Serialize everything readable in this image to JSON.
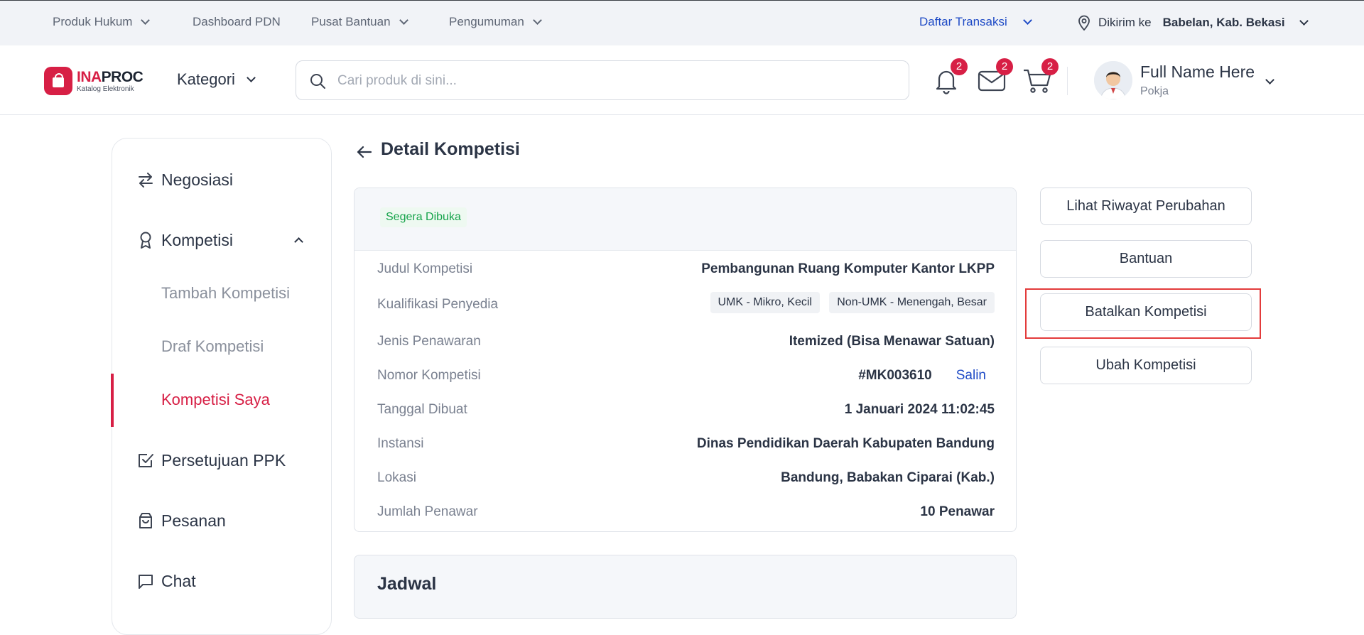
{
  "topbar": {
    "produk_hukum": "Produk Hukum",
    "dashboard_pdn": "Dashboard PDN",
    "pusat_bantuan": "Pusat Bantuan",
    "pengumuman": "Pengumuman",
    "daftar_transaksi": "Daftar Transaksi",
    "dikirim_label": "Dikirim ke",
    "dikirim_value": "Babelan, Kab. Bekasi"
  },
  "header": {
    "logo_ina": "INA",
    "logo_proc": "PROC",
    "logo_sub": "Katalog Elektronik",
    "kategori": "Kategori",
    "search_placeholder": "Cari produk di sini...",
    "notif_count": "2",
    "mail_count": "2",
    "cart_count": "2",
    "user_name": "Full Name Here",
    "user_role": "Pokja"
  },
  "sidebar": {
    "negosiasi": "Negosiasi",
    "kompetisi": "Kompetisi",
    "tambah_kompetisi": "Tambah Kompetisi",
    "draf_kompetisi": "Draf Kompetisi",
    "kompetisi_saya": "Kompetisi Saya",
    "persetujuan_ppk": "Persetujuan PPK",
    "pesanan": "Pesanan",
    "chat": "Chat"
  },
  "page": {
    "title": "Detail Kompetisi",
    "status": "Segera Dibuka",
    "fields": {
      "judul_label": "Judul Kompetisi",
      "judul_value": "Pembangunan Ruang Komputer Kantor LKPP",
      "kualifikasi_label": "Kualifikasi Penyedia",
      "kualifikasi_tag1": "UMK - Mikro, Kecil",
      "kualifikasi_tag2": "Non-UMK - Menengah, Besar",
      "jenis_label": "Jenis Penawaran",
      "jenis_value": "Itemized (Bisa Menawar Satuan)",
      "nomor_label": "Nomor Kompetisi",
      "nomor_value": "#MK003610",
      "salin": "Salin",
      "tanggal_label": "Tanggal Dibuat",
      "tanggal_value": "1 Januari 2024 11:02:45",
      "instansi_label": "Instansi",
      "instansi_value": "Dinas Pendidikan Daerah Kabupaten Bandung",
      "lokasi_label": "Lokasi",
      "lokasi_value": "Bandung, Babakan Ciparai (Kab.)",
      "jumlah_label": "Jumlah Penawar",
      "jumlah_value": "10 Penawar"
    },
    "jadwal_title": "Jadwal"
  },
  "actions": {
    "riwayat": "Lihat Riwayat Perubahan",
    "bantuan": "Bantuan",
    "batalkan": "Batalkan Kompetisi",
    "ubah": "Ubah Kompetisi"
  },
  "colors": {
    "brand": "#d71f45",
    "link": "#1f4bc6",
    "status_green": "#15a34a",
    "highlight": "#e33b3b"
  }
}
